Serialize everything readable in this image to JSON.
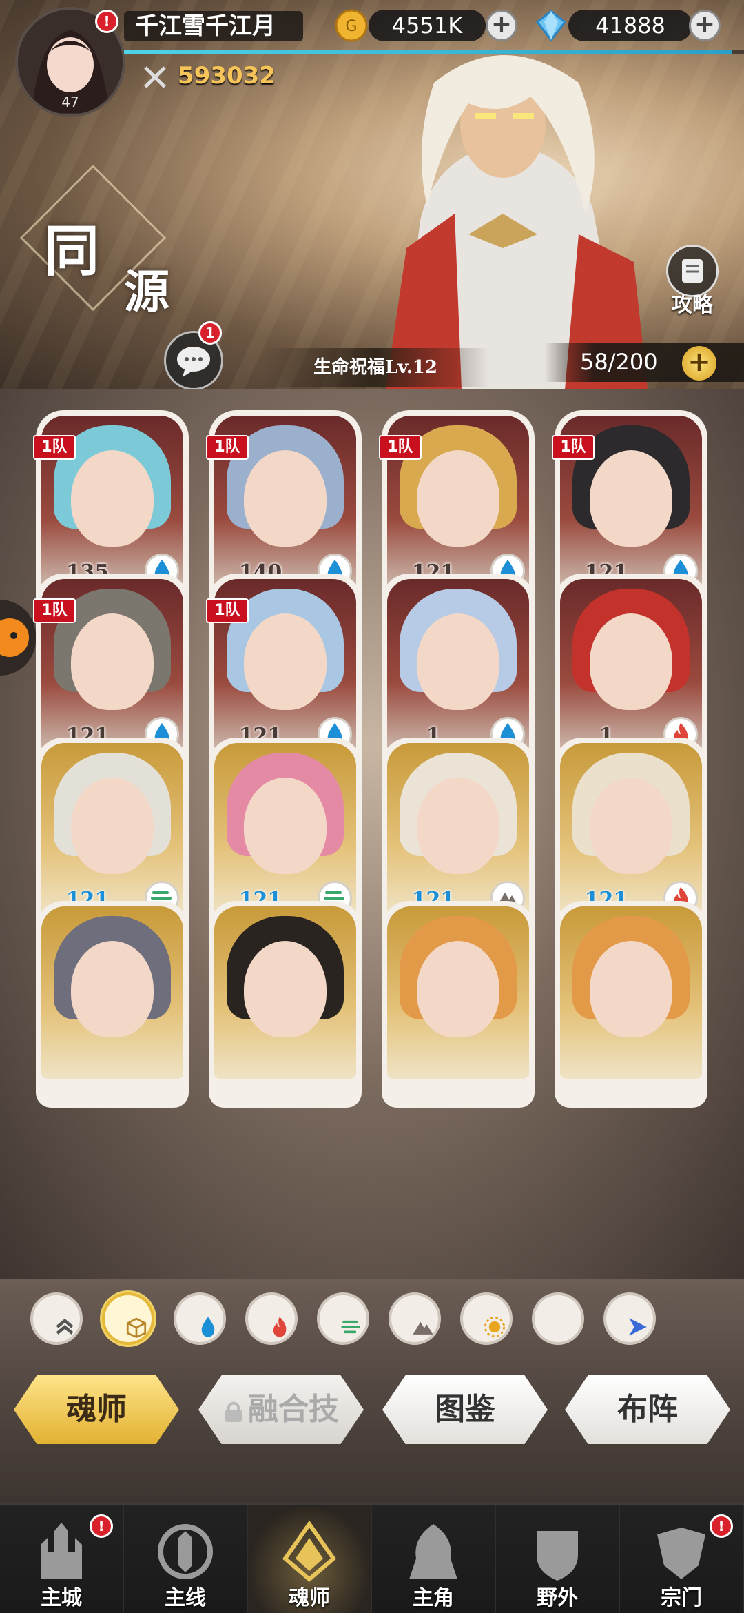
{
  "player": {
    "name": "千江雪千江月",
    "level": "47",
    "power": "593032",
    "xp_fraction": 0.98
  },
  "currency": {
    "gold": "4551K",
    "diamonds": "41888"
  },
  "banner": {
    "title_char_1": "同",
    "title_char_2": "源",
    "guide_label": "攻略",
    "chat_badge": "1",
    "blessing": "生命祝福Lv.12",
    "capacity": "58/200"
  },
  "cards": [
    {
      "team": "1队",
      "level": "135",
      "element": "water",
      "stars": "★★★",
      "rarity": "red",
      "hair": "#7cc9d8"
    },
    {
      "team": "1队",
      "level": "140",
      "element": "water",
      "stars": "★★",
      "rarity": "red",
      "hair": "#9ab0cc"
    },
    {
      "team": "1队",
      "level": "121",
      "element": "water",
      "stars": "★★",
      "rarity": "red",
      "hair": "#d8a94e"
    },
    {
      "team": "1队",
      "level": "121",
      "element": "water",
      "stars": "★★",
      "rarity": "red",
      "hair": "#2c2a2c"
    },
    {
      "team": "1队",
      "level": "121",
      "element": "water",
      "stars": "★★",
      "rarity": "red",
      "hair": "#7b776f"
    },
    {
      "team": "1队",
      "level": "121",
      "element": "water",
      "stars": "★★",
      "rarity": "red",
      "hair": "#a9c7e3"
    },
    {
      "team": "",
      "level": "1",
      "element": "water",
      "stars": "★",
      "rarity": "red",
      "hair": "#b7cbe6"
    },
    {
      "team": "",
      "level": "1",
      "element": "fire",
      "stars": "★",
      "rarity": "red",
      "hair": "#c4322c"
    },
    {
      "team": "",
      "level": "121",
      "element": "wind",
      "stars": "★★★★★",
      "rarity": "gold",
      "hair": "#e3e0d8"
    },
    {
      "team": "",
      "level": "121",
      "element": "wind",
      "stars": "★★★★★",
      "rarity": "gold",
      "hair": "#e58aa4"
    },
    {
      "team": "",
      "level": "121",
      "element": "earth",
      "stars": "★★★★★",
      "rarity": "gold",
      "hair": "#ebe4d6"
    },
    {
      "team": "",
      "level": "121",
      "element": "fire",
      "stars": "★★★★★",
      "rarity": "gold",
      "hair": "#eae0cc"
    },
    {
      "team": "",
      "level": "",
      "element": "",
      "stars": "",
      "rarity": "gold",
      "hair": "#6f6e7c"
    },
    {
      "team": "",
      "level": "",
      "element": "",
      "stars": "",
      "rarity": "gold",
      "hair": "#2a2421"
    },
    {
      "team": "",
      "level": "",
      "element": "",
      "stars": "",
      "rarity": "gold",
      "hair": "#e39a48"
    },
    {
      "team": "",
      "level": "",
      "element": "",
      "stars": "",
      "rarity": "gold",
      "hair": "#e39a48"
    }
  ],
  "filters": [
    "sort-icon",
    "all-box-icon",
    "water-icon",
    "fire-icon",
    "wind-icon",
    "earth-icon",
    "light-icon",
    "dark-icon",
    "special-icon"
  ],
  "active_filter": 1,
  "tabs": {
    "soul_master": "魂师",
    "fusion": "融合技",
    "codex": "图鉴",
    "formation": "布阵"
  },
  "nav": [
    {
      "label": "主城",
      "badge": "!"
    },
    {
      "label": "主线",
      "badge": ""
    },
    {
      "label": "魂师",
      "badge": ""
    },
    {
      "label": "主角",
      "badge": ""
    },
    {
      "label": "野外",
      "badge": ""
    },
    {
      "label": "宗门",
      "badge": "!"
    }
  ],
  "colors": {
    "accent_gold": "#e5b93a",
    "badge_red": "#d8212b",
    "team_tag": "#c8101e",
    "water": "#1d8fd6",
    "fire": "#e0453a",
    "wind": "#3aa86a",
    "earth": "#7a6f68"
  }
}
